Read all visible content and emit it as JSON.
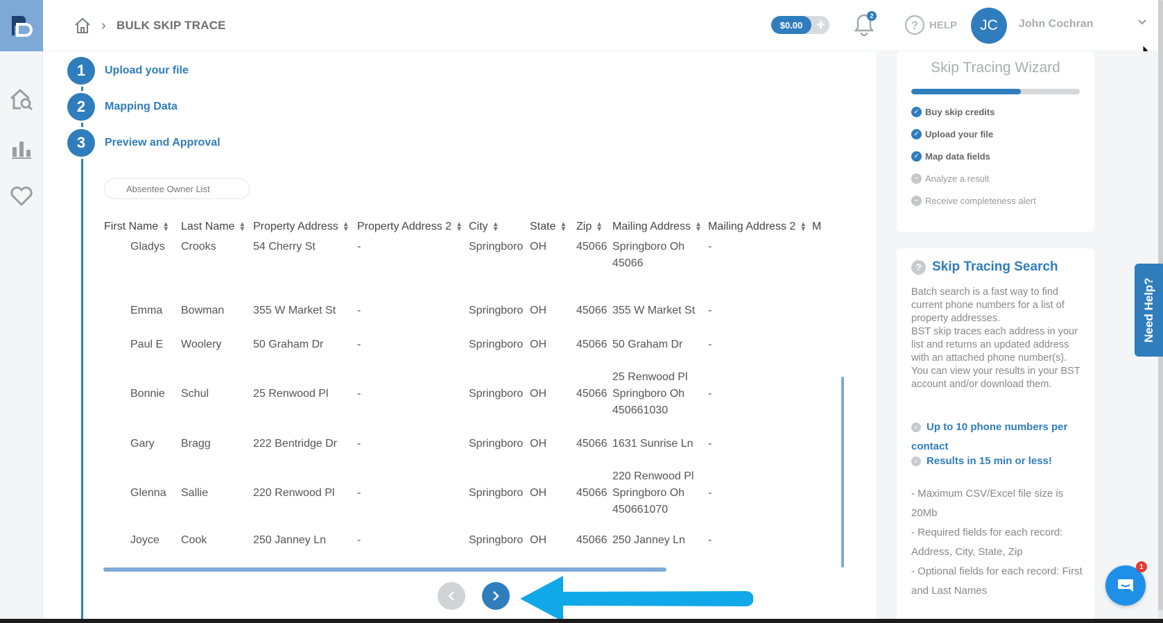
{
  "breadcrumb": {
    "title": "BULK SKIP TRACE"
  },
  "header": {
    "balance": "$0.00",
    "notification_count": "2",
    "help_label": "HELP",
    "avatar_initials": "JC",
    "user_name": "John Cochran"
  },
  "steps": [
    {
      "num": "1",
      "label": "Upload your file"
    },
    {
      "num": "2",
      "label": "Mapping Data"
    },
    {
      "num": "3",
      "label": "Preview and Approval"
    }
  ],
  "list_name": "Absentee Owner List",
  "table": {
    "columns": [
      "First Name",
      "Last Name",
      "Property Address",
      "Property Address 2",
      "City",
      "State",
      "Zip",
      "Mailing Address",
      "Mailing Address 2",
      "M"
    ],
    "rows": [
      [
        "Gladys",
        "Crooks",
        "54 Cherry St",
        "-",
        "Springboro",
        "OH",
        "45066",
        [
          "Springboro Oh",
          "45066"
        ],
        "-"
      ],
      [
        "Emma",
        "Bowman",
        "355 W Market St",
        "-",
        "Springboro",
        "OH",
        "45066",
        [
          "355 W Market St"
        ],
        "-"
      ],
      [
        "Paul E",
        "Woolery",
        "50 Graham Dr",
        "-",
        "Springboro",
        "OH",
        "45066",
        [
          "50 Graham Dr"
        ],
        "-"
      ],
      [
        "Bonnie",
        "Schul",
        "25 Renwood Pl",
        "-",
        "Springboro",
        "OH",
        "45066",
        [
          "25 Renwood Pl",
          "Springboro Oh",
          "450661030"
        ],
        "-"
      ],
      [
        "Gary",
        "Bragg",
        "222 Bentridge Dr",
        "-",
        "Springboro",
        "OH",
        "45066",
        [
          "1631 Sunrise Ln"
        ],
        "-"
      ],
      [
        "Glenna",
        "Sallie",
        "220 Renwood Pl",
        "-",
        "Springboro",
        "OH",
        "45066",
        [
          "220 Renwood Pl",
          "Springboro Oh",
          "450661070"
        ],
        "-"
      ],
      [
        "Joyce",
        "Cook",
        "250 Janney Ln",
        "-",
        "Springboro",
        "OH",
        "45066",
        [
          "250 Janney Ln"
        ],
        "-"
      ]
    ]
  },
  "wizard": {
    "title": "Skip Tracing Wizard",
    "progress": 0.65,
    "items": [
      {
        "label": "Buy skip credits",
        "done": true
      },
      {
        "label": "Upload your file",
        "done": true
      },
      {
        "label": "Map data fields",
        "done": true
      },
      {
        "label": "Analyze a result",
        "done": false
      },
      {
        "label": "Receive completeness alert",
        "done": false
      }
    ]
  },
  "search_card": {
    "title": "Skip Tracing Search",
    "description": "Batch search is a fast way to find current phone numbers for a list of property addresses.\nBST skip traces each address in your list and returns an updated address with an attached phone number(s). You can view your results in your BST account and/or download them.",
    "features": [
      "Up to 10 phone numbers per contact",
      "Results in 15 min or less!"
    ],
    "notes": [
      "- Maximum CSV/Excel file size is 20Mb",
      "- Required fields for each record: Address, City, State, Zip",
      "- Optional fields for each record: First and Last Names"
    ]
  },
  "need_help": "Need Help?",
  "chat_badge": "1",
  "colors": {
    "primary": "#2f7dbd",
    "arrow": "#10a8e8",
    "logo_bg": "#7ea9d6"
  },
  "icons": [
    "logo-icon",
    "home-search-icon",
    "bar-chart-icon",
    "heart-icon",
    "home-icon",
    "bell-icon",
    "help-icon",
    "chevron-down-icon",
    "chat-icon",
    "check-icon"
  ]
}
